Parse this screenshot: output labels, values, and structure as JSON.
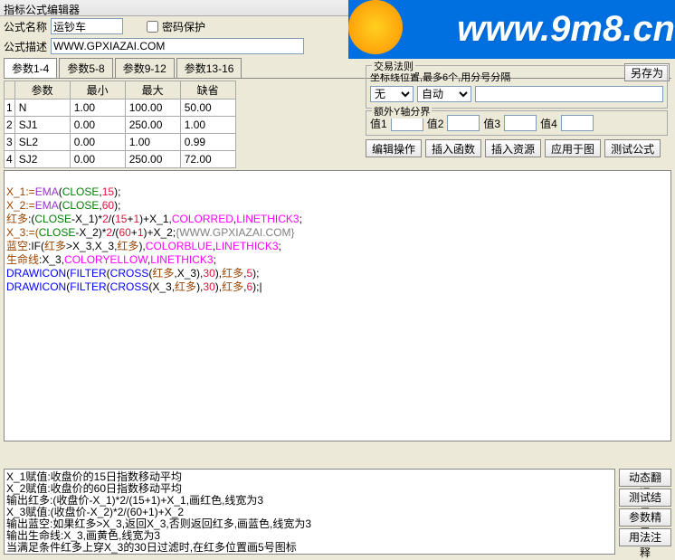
{
  "title": "指标公式编辑器",
  "watermark": "www.9m8.cn",
  "header": {
    "name_label": "公式名称",
    "name_value": "运钞车",
    "pwd_label": "密码保护",
    "cat1_label": "公式",
    "desc_label": "公式描述",
    "desc_value": "WWW.GPXIAZAI.COM",
    "cat2_label": "公式"
  },
  "save_as_btn": "另存为",
  "tabs": [
    "参数1-4",
    "参数5-8",
    "参数9-12",
    "参数13-16"
  ],
  "param_headers": [
    "",
    "参数",
    "最小",
    "最大",
    "缺省"
  ],
  "params": [
    {
      "i": "1",
      "name": "N",
      "min": "1.00",
      "max": "100.00",
      "def": "50.00"
    },
    {
      "i": "2",
      "name": "SJ1",
      "min": "0.00",
      "max": "250.00",
      "def": "1.00"
    },
    {
      "i": "3",
      "name": "SL2",
      "min": "0.00",
      "max": "1.00",
      "def": "0.99"
    },
    {
      "i": "4",
      "name": "SJ2",
      "min": "0.00",
      "max": "250.00",
      "def": "72.00"
    }
  ],
  "rules": {
    "legend": "交易法则",
    "note": "坐标线位置,最多6个,用分号分隔",
    "sel_label": "无",
    "sel_value": "自动"
  },
  "extra": {
    "legend": "额外Y轴分界",
    "v1": "值1",
    "v2": "值2",
    "v3": "值3",
    "v4": "值4"
  },
  "opbtns": [
    "编辑操作",
    "插入函数",
    "插入资源",
    "应用于图",
    "测试公式"
  ],
  "rightbtns": [
    "动态翻译",
    "测试结果",
    "参数精灵",
    "用法注释"
  ],
  "code": {
    "l1a": "X_1:=",
    "l1b": "EMA",
    "l1c": "(",
    "l1d": "CLOSE",
    "l1e": ",",
    "l1f": "15",
    "l1g": ");",
    "l2a": "X_2:=",
    "l2b": "EMA",
    "l2c": "(",
    "l2d": "CLOSE",
    "l2e": ",",
    "l2f": "60",
    "l2g": ");",
    "l3a": "红多",
    "l3b": ":(",
    "l3c": "CLOSE",
    "l3d": "-X_1)*",
    "l3e": "2",
    "l3f": "/(",
    "l3g": "15",
    "l3h": "+",
    "l3i": "1",
    "l3j": ")+X_1,",
    "l3k": "COLORRED",
    "l3l": ",",
    "l3m": "LINETHICK3",
    "l3n": ";",
    "l4a": "X_3:=(",
    "l4b": "CLOSE",
    "l4c": "-X_2)*",
    "l4d": "2",
    "l4e": "/(",
    "l4f": "60",
    "l4g": "+",
    "l4h": "1",
    "l4i": ")+X_2;",
    "l4j": "{WWW.GPXIAZAI.COM}",
    "l5a": "蓝空",
    "l5b": ":IF(",
    "l5c": "红多",
    "l5d": ">X_3,X_3,",
    "l5e": "红多",
    "l5f": "),",
    "l5g": "COLORBLUE",
    "l5h": ",",
    "l5i": "LINETHICK3",
    "l5j": ";",
    "l6a": "生命线",
    "l6b": ":X_3,",
    "l6c": "COLORYELLOW",
    "l6d": ",",
    "l6e": "LINETHICK3",
    "l6f": ";",
    "l7a": "DRAWICON",
    "l7b": "(",
    "l7c": "FILTER",
    "l7d": "(",
    "l7e": "CROSS",
    "l7f": "(",
    "l7g": "红多",
    "l7h": ",X_3),",
    "l7i": "30",
    "l7j": "),",
    "l7k": "红多",
    "l7l": ",",
    "l7m": "5",
    "l7n": ");",
    "l8a": "DRAWICON",
    "l8b": "(",
    "l8c": "FILTER",
    "l8d": "(",
    "l8e": "CROSS",
    "l8f": "(X_3,",
    "l8g": "红多",
    "l8h": "),",
    "l8i": "30",
    "l8j": "),",
    "l8k": "红多",
    "l8l": ",",
    "l8m": "6",
    "l8n": ");|"
  },
  "explain": [
    "X_1赋值:收盘价的15日指数移动平均",
    "X_2赋值:收盘价的60日指数移动平均",
    "输出红多:(收盘价-X_1)*2/(15+1)+X_1,画红色,线宽为3",
    "X_3赋值:(收盘价-X_2)*2/(60+1)+X_2",
    "输出蓝空:如果红多>X_3,返回X_3,否则返回红多,画蓝色,线宽为3",
    "输出生命线:X_3,画黄色,线宽为3",
    "当满足条件红多上穿X_3的30日过滤时,在红多位置画5号图标"
  ]
}
